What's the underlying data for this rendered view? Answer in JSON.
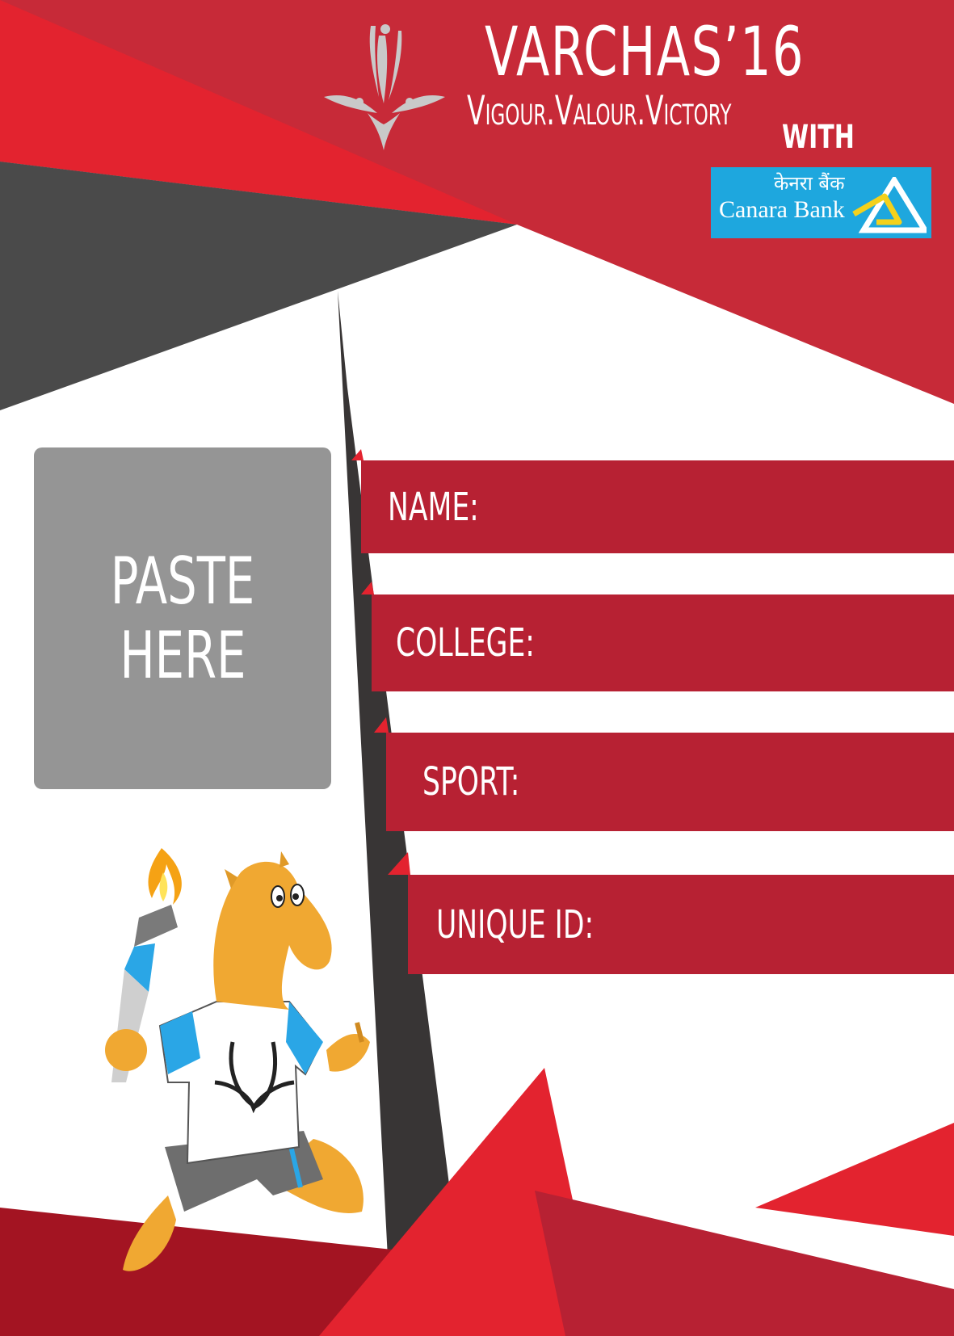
{
  "header": {
    "title": "VARCHAS’16",
    "tagline": "Vigour.Valour.Victory",
    "with_label": "WITH"
  },
  "sponsor": {
    "name_hindi": "केनरा बैंक",
    "name": "Canara Bank",
    "logo_icon": "canara-bank-triangle-icon"
  },
  "photo_box": {
    "line1": "PASTE",
    "line2": "HERE"
  },
  "fields": [
    {
      "label": "NAME:"
    },
    {
      "label": "COLLEGE:"
    },
    {
      "label": "SPORT:"
    },
    {
      "label": "UNIQUE ID:"
    }
  ],
  "mascot": {
    "icon": "camel-mascot-with-torch"
  },
  "colors": {
    "primary_red": "#c72a38",
    "bright_red": "#e3232f",
    "band_red": "#b72133",
    "dark_red": "#a31422",
    "dark_gray": "#4a4a4a",
    "photo_gray": "#959595",
    "sponsor_blue": "#1ea7de"
  }
}
